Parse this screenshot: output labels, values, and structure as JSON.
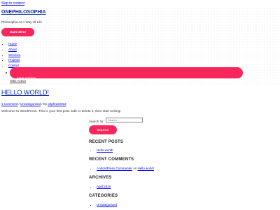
{
  "skip_link": "Skip to content",
  "site": {
    "title": "ONEPHILOSOPHIA",
    "tagline": "Philosophia As A Way Of Life"
  },
  "menu_button": "MAIN MENU",
  "nav": {
    "items": [
      "Home",
      "About",
      "Services",
      "Projects",
      "Contact"
    ],
    "take_action_button": "TAKE ACTION",
    "take_action_link": "Take Action"
  },
  "post": {
    "title": "HELLO WORLD!",
    "comments": "1 Comment",
    "sep1": " / ",
    "category": "Uncategorized",
    "sep2": " / By ",
    "author": "p3phraz2012",
    "excerpt": "Welcome to WordPress. This is your first post. Edit or delete it, then start writing!"
  },
  "search": {
    "label": "Search for:",
    "placeholder": "Search ...",
    "button": "SEARCH"
  },
  "widgets": {
    "recent_posts": {
      "title": "RECENT POSTS",
      "items": [
        "Hello world!"
      ]
    },
    "recent_comments": {
      "title": "RECENT COMMENTS",
      "author": "A WordPress Commenter",
      "on": " on ",
      "post": "Hello world!"
    },
    "archives": {
      "title": "ARCHIVES",
      "items": [
        "April 2020"
      ]
    },
    "categories": {
      "title": "CATEGORIES",
      "items": [
        "Uncategorized"
      ]
    }
  },
  "colors": {
    "accent": "#f7265b",
    "title_blue": "#0b2aa6",
    "link": "#0000ee"
  }
}
